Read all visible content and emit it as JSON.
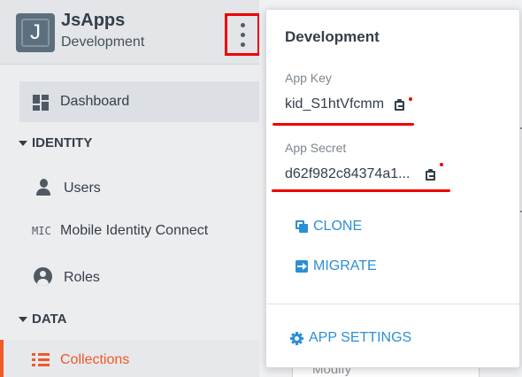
{
  "app": {
    "avatar_letter": "J",
    "name": "JsApps",
    "environment": "Development"
  },
  "sidebar": {
    "dashboard_label": "Dashboard",
    "sections": [
      {
        "title": "IDENTITY",
        "items": [
          {
            "label": "Users",
            "icon": "user-icon"
          },
          {
            "label": "Mobile Identity Connect",
            "icon": "mic-icon",
            "icon_text": "MIC"
          },
          {
            "label": "Roles",
            "icon": "roles-icon"
          }
        ]
      },
      {
        "title": "DATA",
        "items": [
          {
            "label": "Collections",
            "icon": "list-icon",
            "active": true
          }
        ]
      }
    ]
  },
  "popover": {
    "title": "Development",
    "app_key_label": "App Key",
    "app_key_value": "kid_S1htVfcmm",
    "app_secret_label": "App Secret",
    "app_secret_value": "d62f982c84374a1...",
    "actions": {
      "clone": "CLONE",
      "migrate": "MIGRATE",
      "settings": "APP SETTINGS"
    }
  },
  "background": {
    "card_text": "Modify"
  },
  "colors": {
    "accent": "#2b8fd6",
    "active": "#f05a28",
    "annotation": "#f00000"
  }
}
